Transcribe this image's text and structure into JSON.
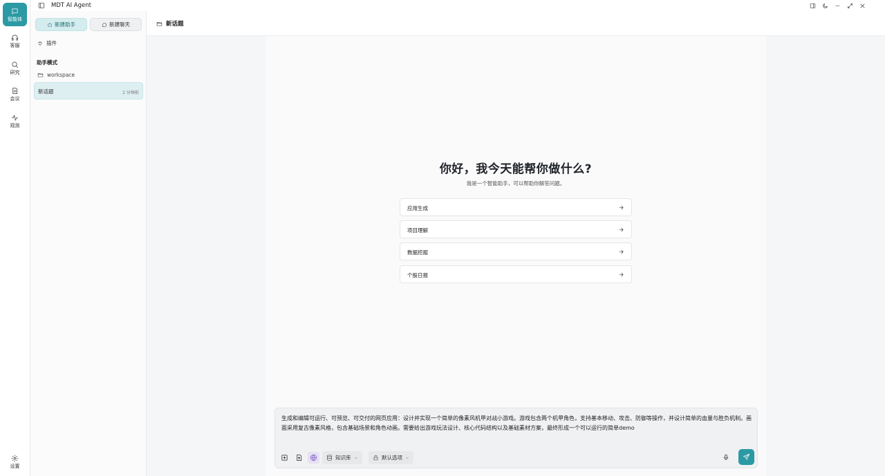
{
  "app": {
    "title": "MDT AI Agent"
  },
  "rail": {
    "items": [
      {
        "label": "智能体",
        "icon": "chat-bubble-icon"
      },
      {
        "label": "客服",
        "icon": "headphones-icon"
      },
      {
        "label": "研究",
        "icon": "search-icon"
      },
      {
        "label": "会议",
        "icon": "document-icon"
      },
      {
        "label": "观测",
        "icon": "activity-icon"
      }
    ],
    "settings_label": "设置"
  },
  "sidebar": {
    "new_assistant_label": "新建助手",
    "new_chat_label": "新建聊天",
    "plugin_label": "插件",
    "section_title": "助手模式",
    "folder_label": "workspace",
    "topic": {
      "name": "新话题",
      "time": "2 分钟前"
    }
  },
  "main": {
    "header_title": "新话题",
    "hero_title": "你好，我今天能帮你做什么?",
    "hero_subtitle": "我是一个智能助手，可以帮助你解答问题。",
    "suggestions": [
      "应用生成",
      "项目理解",
      "数据挖掘",
      "个股日报"
    ]
  },
  "composer": {
    "text": "生成和编辑可运行、可预览、可交付的网页应用：设计并实现一个简单的像素风机甲对战小游戏。游戏包含两个机甲角色，支持基本移动、攻击、防御等操作，并设计简单的血量与胜负机制。画面采用复古像素风格，包含基础场景和角色动画。需要给出游戏玩法设计、核心代码结构以及基础素材方案，最终形成一个可以运行的简单demo",
    "knowledge_label": "知识库",
    "options_label": "默认选项"
  },
  "colors": {
    "accent": "#2b9aa4",
    "accent_light": "#d5ecee"
  }
}
